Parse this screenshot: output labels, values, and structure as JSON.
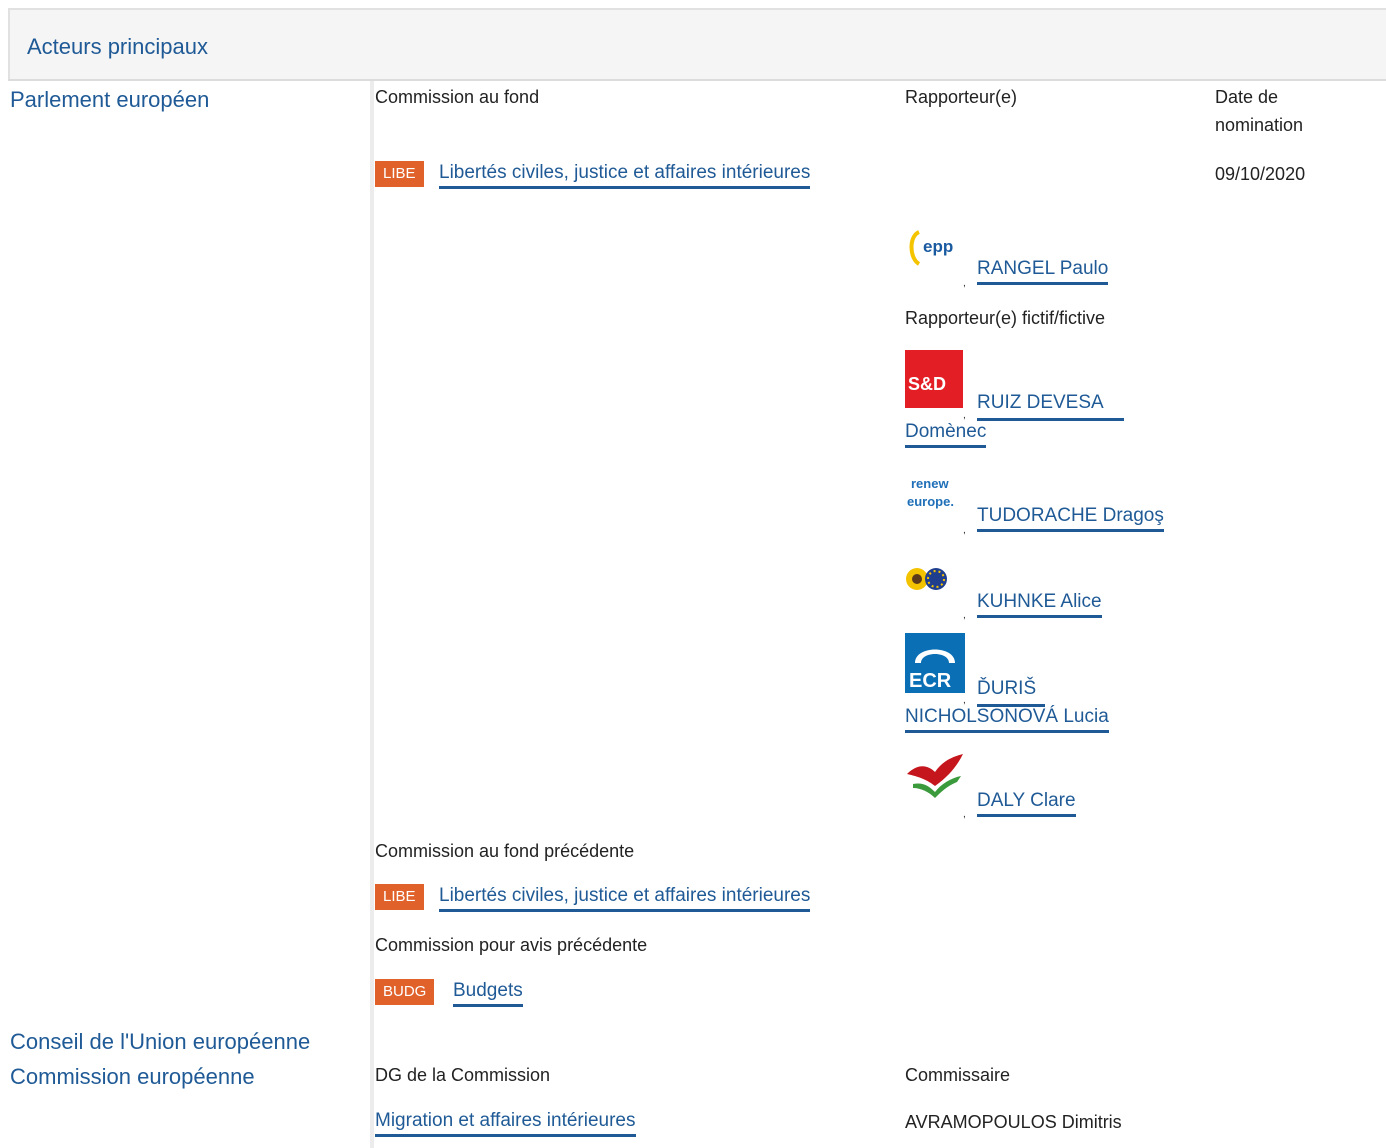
{
  "section": {
    "title": "Acteurs principaux"
  },
  "actors": {
    "parliament": "Parlement européen",
    "council": "Conseil de l'Union européenne",
    "commission": "Commission européenne"
  },
  "parliament": {
    "col_committee": "Commission au fond",
    "col_rapporteur": "Rapporteur(e)",
    "col_date": "Date de nomination",
    "committee": {
      "badge": "LIBE",
      "name": "Libertés civiles, justice et affaires intérieures"
    },
    "date": "09/10/2020",
    "rapporteur": {
      "group_logo": "epp-logo",
      "name": "RANGEL Paulo"
    },
    "shadow_label": "Rapporteur(e) fictif/fictive",
    "shadows": [
      {
        "group_logo": "sd-logo",
        "logo_text": "S&D",
        "name_line1": "RUIZ DEVESA",
        "name_line2": "Domènec"
      },
      {
        "group_logo": "renew-europe-logo",
        "logo_text1": "renew",
        "logo_text2": "europe.",
        "name": "TUDORACHE Dragoş"
      },
      {
        "group_logo": "greens-efa-logo",
        "name": "KUHNKE Alice"
      },
      {
        "group_logo": "ecr-logo",
        "logo_text": "ECR",
        "name_line1": "ĎURIŠ",
        "name_line2": "NICHOLSONOVÁ Lucia"
      },
      {
        "group_logo": "gue-ngl-logo",
        "name": "DALY Clare"
      }
    ],
    "previous_committee_label": "Commission au fond précédente",
    "previous_committee": {
      "badge": "LIBE",
      "name": "Libertés civiles, justice et affaires intérieures"
    },
    "previous_opinion_label": "Commission pour avis précédente",
    "previous_opinion": {
      "badge": "BUDG",
      "name": "Budgets"
    }
  },
  "commission": {
    "col_dg": "DG de la Commission",
    "col_commissioner": "Commissaire",
    "dg": "Migration et affaires intérieures",
    "commissioner": "AVRAMOPOULOS Dimitris"
  },
  "colors": {
    "link": "#1f5a96",
    "badge": "#e0612a"
  }
}
